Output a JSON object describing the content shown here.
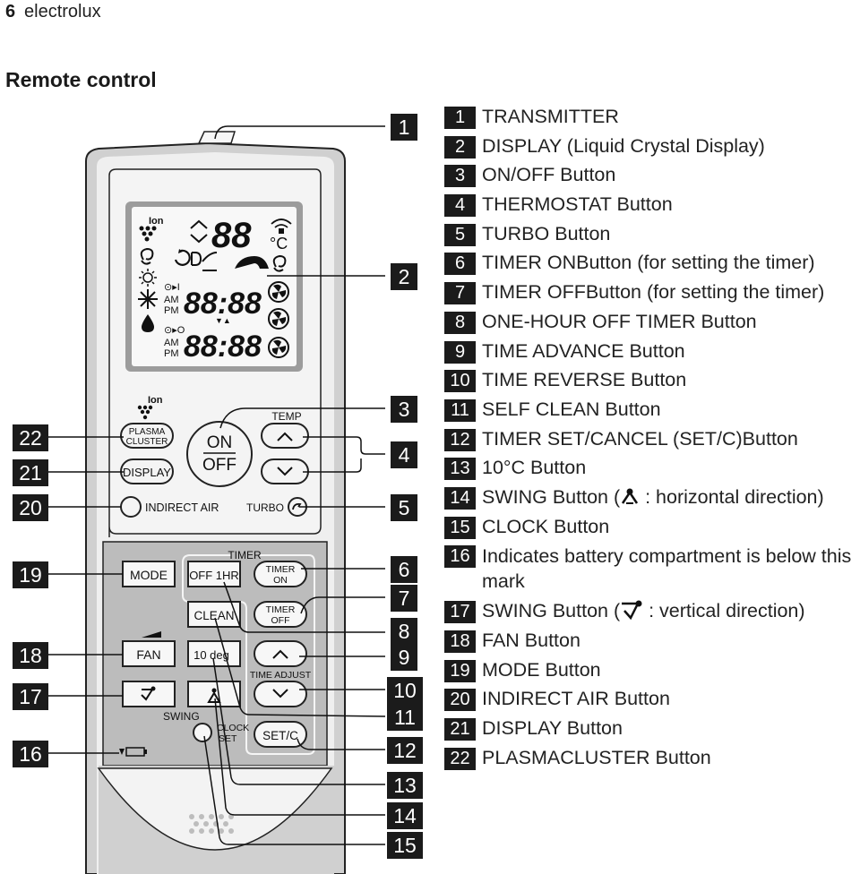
{
  "header": {
    "page_number": "6",
    "brand": "electrolux",
    "section_title": "Remote control"
  },
  "remote": {
    "display": {
      "ion_label": "Ion",
      "temp_digits": "88",
      "temp_unit": "°C",
      "timer_on_digits": "88:88",
      "timer_off_digits": "88:88",
      "am": "AM",
      "pm": "PM",
      "arrows": "▼▲"
    },
    "buttons": {
      "plasma_ion": "Ion",
      "plasma_line1": "PLASMA",
      "plasma_line2": "CLUSTER",
      "display": "DISPLAY",
      "on": "ON",
      "off": "OFF",
      "temp_label": "TEMP",
      "indirect_air": "INDIRECT AIR",
      "turbo": "TURBO",
      "timer_group_label": "TIMER",
      "mode": "MODE",
      "off_1hr": "OFF 1HR",
      "timer_on_line1": "TIMER",
      "timer_on_line2": "ON",
      "clean": "CLEAN",
      "timer_off_line1": "TIMER",
      "timer_off_line2": "OFF",
      "fan": "FAN",
      "ten_deg": "10 deg",
      "time_adjust": "TIME ADJUST",
      "swing": "SWING",
      "clock_line1": "CLOCK",
      "clock_line2": "SET",
      "set_c": "SET/C"
    }
  },
  "callouts_left": [
    {
      "n": "22"
    },
    {
      "n": "21"
    },
    {
      "n": "20"
    },
    {
      "n": "19"
    },
    {
      "n": "18"
    },
    {
      "n": "17"
    },
    {
      "n": "16"
    }
  ],
  "callouts_right": [
    {
      "n": "1"
    },
    {
      "n": "2"
    },
    {
      "n": "3"
    },
    {
      "n": "4"
    },
    {
      "n": "5"
    },
    {
      "n": "6"
    },
    {
      "n": "7"
    },
    {
      "n": "8"
    },
    {
      "n": "9"
    },
    {
      "n": "10"
    },
    {
      "n": "11"
    },
    {
      "n": "12"
    },
    {
      "n": "13"
    },
    {
      "n": "14"
    },
    {
      "n": "15"
    }
  ],
  "legend": [
    {
      "n": "1",
      "text": "TRANSMITTER"
    },
    {
      "n": "2",
      "text": "DISPLAY (Liquid Crystal Display)"
    },
    {
      "n": "3",
      "text": "ON/OFF Button"
    },
    {
      "n": "4",
      "text": "THERMOSTAT Button"
    },
    {
      "n": "5",
      "text": "TURBO Button"
    },
    {
      "n": "6",
      "text": "TIMER ONButton (for setting the timer)"
    },
    {
      "n": "7",
      "text": "TIMER OFFButton (for setting the timer)"
    },
    {
      "n": "8",
      "text": "ONE-HOUR OFF TIMER Button"
    },
    {
      "n": "9",
      "text": "TIME ADVANCE Button"
    },
    {
      "n": "10",
      "text": "TIME REVERSE Button"
    },
    {
      "n": "11",
      "text": "SELF CLEAN Button"
    },
    {
      "n": "12",
      "text": "TIMER SET/CANCEL (SET/C)Button"
    },
    {
      "n": "13",
      "text": "10°C Button"
    },
    {
      "n": "14",
      "text_before": "SWING Button (",
      "icon": "swing-horizontal-icon",
      "text_after": " : horizontal direction)"
    },
    {
      "n": "15",
      "text": "CLOCK Button"
    },
    {
      "n": "16",
      "text": "Indicates battery compartment is below this mark"
    },
    {
      "n": "17",
      "text_before": "SWING Button (",
      "icon": "swing-vertical-icon",
      "text_after": " : vertical direction)"
    },
    {
      "n": "18",
      "text": "FAN Button"
    },
    {
      "n": "19",
      "text": "MODE Button"
    },
    {
      "n": "20",
      "text": "INDIRECT AIR Button"
    },
    {
      "n": "21",
      "text": "DISPLAY Button"
    },
    {
      "n": "22",
      "text": "PLASMACLUSTER Button"
    }
  ],
  "colors": {
    "badge": "#1b1b1b",
    "remote_body": "#f2f2f2",
    "remote_side": "#cfcfcf",
    "lower_panel": "#bdbdbd",
    "lcd_frame": "#9a9a9a"
  }
}
